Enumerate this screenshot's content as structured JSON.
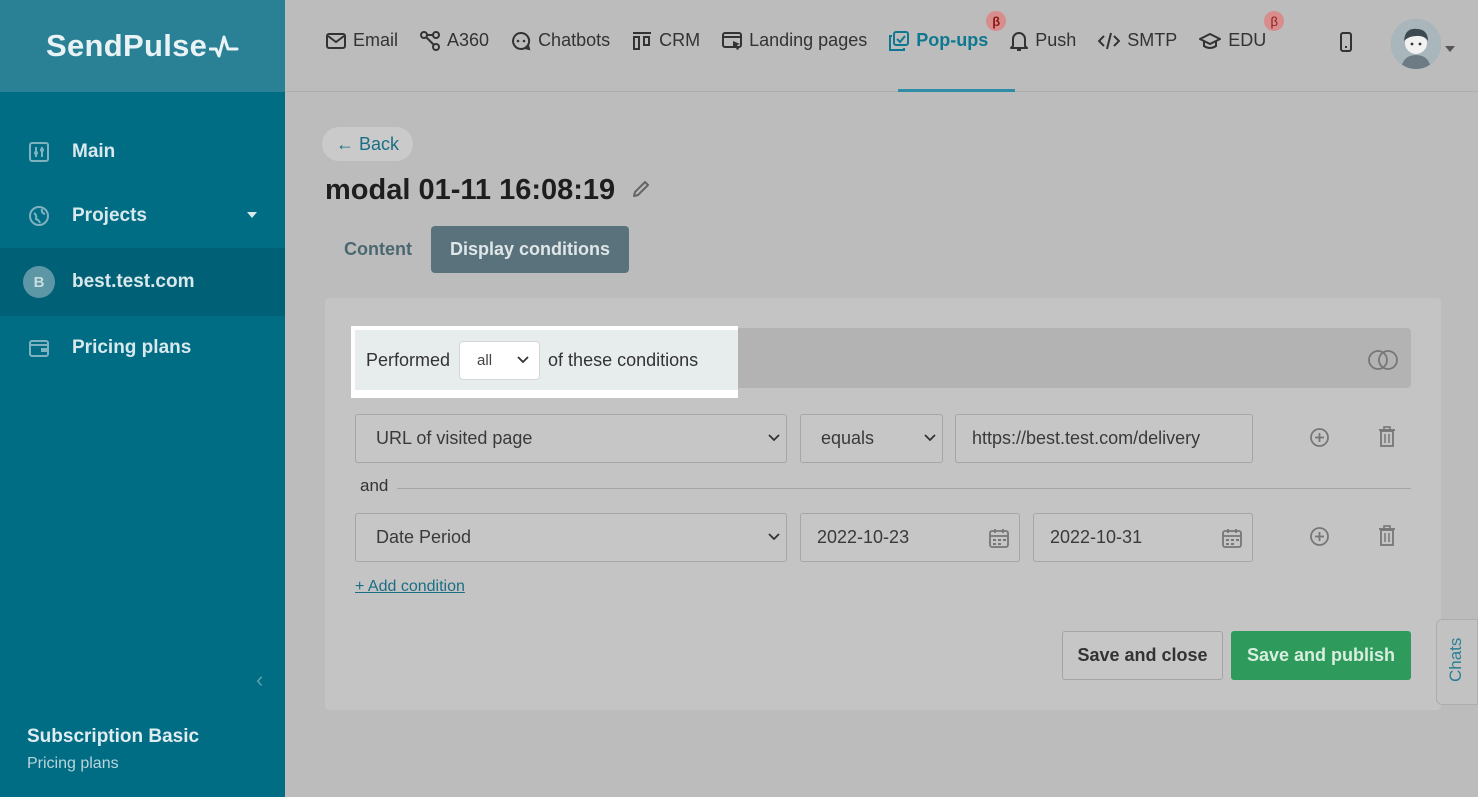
{
  "brand": {
    "logo_text": "SendPulse"
  },
  "sidebar": {
    "items": [
      {
        "label": "Main",
        "icon": "dashboard-icon"
      },
      {
        "label": "Projects",
        "icon": "globe-icon"
      },
      {
        "label": "best.test.com",
        "icon": "project-avatar",
        "avatar_letter": "B"
      },
      {
        "label": "Pricing plans",
        "icon": "wallet-icon"
      }
    ],
    "subscription_title": "Subscription Basic",
    "subscription_link": "Pricing plans"
  },
  "topnav": {
    "items": [
      {
        "label": "Email",
        "icon": "envelope-icon"
      },
      {
        "label": "A360",
        "icon": "nodes-icon"
      },
      {
        "label": "Chatbots",
        "icon": "chat-icon"
      },
      {
        "label": "CRM",
        "icon": "kanban-icon"
      },
      {
        "label": "Landing pages",
        "icon": "landing-icon"
      },
      {
        "label": "Pop-ups",
        "icon": "popup-icon",
        "active": true,
        "beta": "β"
      },
      {
        "label": "Push",
        "icon": "bell-icon"
      },
      {
        "label": "SMTP",
        "icon": "code-icon"
      },
      {
        "label": "EDU",
        "icon": "graduation-icon",
        "beta": "β"
      }
    ]
  },
  "page": {
    "back_label": "← Back",
    "title": "modal 01-11 16:08:19",
    "tabs": [
      {
        "label": "Content"
      },
      {
        "label": "Display conditions",
        "active": true
      }
    ]
  },
  "conditions": {
    "performed_label": "Performed",
    "match_value": "all",
    "suffix_label": "of these conditions",
    "rows": [
      {
        "field": "URL of visited page",
        "operator": "equals",
        "value": "https://best.test.com/delivery"
      },
      {
        "field": "Date Period",
        "date_from": "2022-10-23",
        "date_to": "2022-10-31"
      }
    ],
    "joiner": "and",
    "add_label": "+ Add condition"
  },
  "actions": {
    "save_close": "Save and close",
    "save_publish": "Save and publish"
  },
  "chats_label": "Chats",
  "colors": {
    "sidebar": "#006d85",
    "accent": "#0f7891",
    "publish": "#2e9a5c"
  }
}
